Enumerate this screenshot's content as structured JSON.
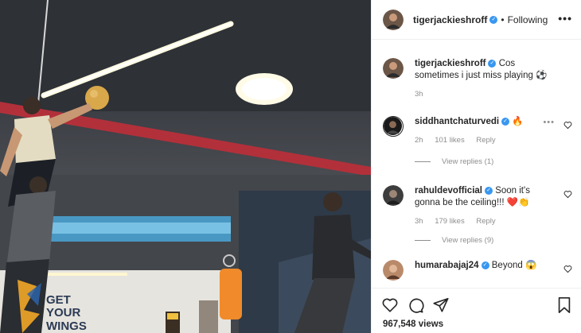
{
  "post": {
    "author": "tigerjackieshroff",
    "follow_status": "Following",
    "dot": "•",
    "more": "•••"
  },
  "media": {
    "wall_sign": [
      "GET",
      "YOUR",
      "WINGS"
    ]
  },
  "comments": [
    {
      "user": "tigerjackieshroff",
      "text": "Cos sometimes i just miss playing ⚽",
      "time": "3h"
    },
    {
      "user": "siddhantchaturvedi",
      "text": "🔥",
      "time": "2h",
      "likes": "101 likes",
      "reply": "Reply",
      "view_replies": "View replies (1)"
    },
    {
      "user": "rahuldevofficial",
      "text": "Soon it's gonna be the ceiling!!! ❤️👏",
      "time": "3h",
      "likes": "179 likes",
      "reply": "Reply",
      "view_replies": "View replies (9)"
    },
    {
      "user": "humarabajaj24",
      "text": "Beyond 😱"
    }
  ],
  "footer": {
    "views": "967,548 views"
  },
  "icons": {
    "like": "heart-icon",
    "comment": "comment-icon",
    "share": "share-icon",
    "save": "bookmark-icon",
    "verified": "verified-badge-icon"
  },
  "colors": {
    "verified": "#3897f0",
    "text": "#262626",
    "muted": "#8e8e8e",
    "border": "#efefef"
  }
}
